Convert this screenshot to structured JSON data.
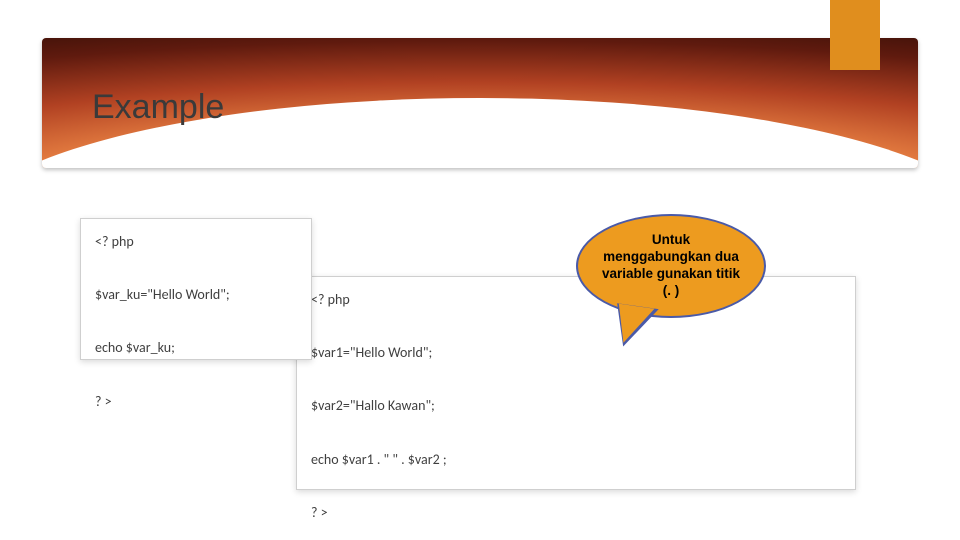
{
  "title": "Example",
  "code1": "<? php\n\n$var_ku=\"Hello World\";\n\necho $var_ku;\n\n? >",
  "code2": "<? php\n\n$var1=\"Hello World\";\n\n$var2=\"Hallo Kawan\";\n\necho $var1 . \" \" . $var2 ;\n\n? >",
  "callout_text": "Untuk menggabungkan dua variable gunakan titik (. )",
  "colors": {
    "accent": "#ed9b1f",
    "bubble_border": "#4a5aa8"
  }
}
